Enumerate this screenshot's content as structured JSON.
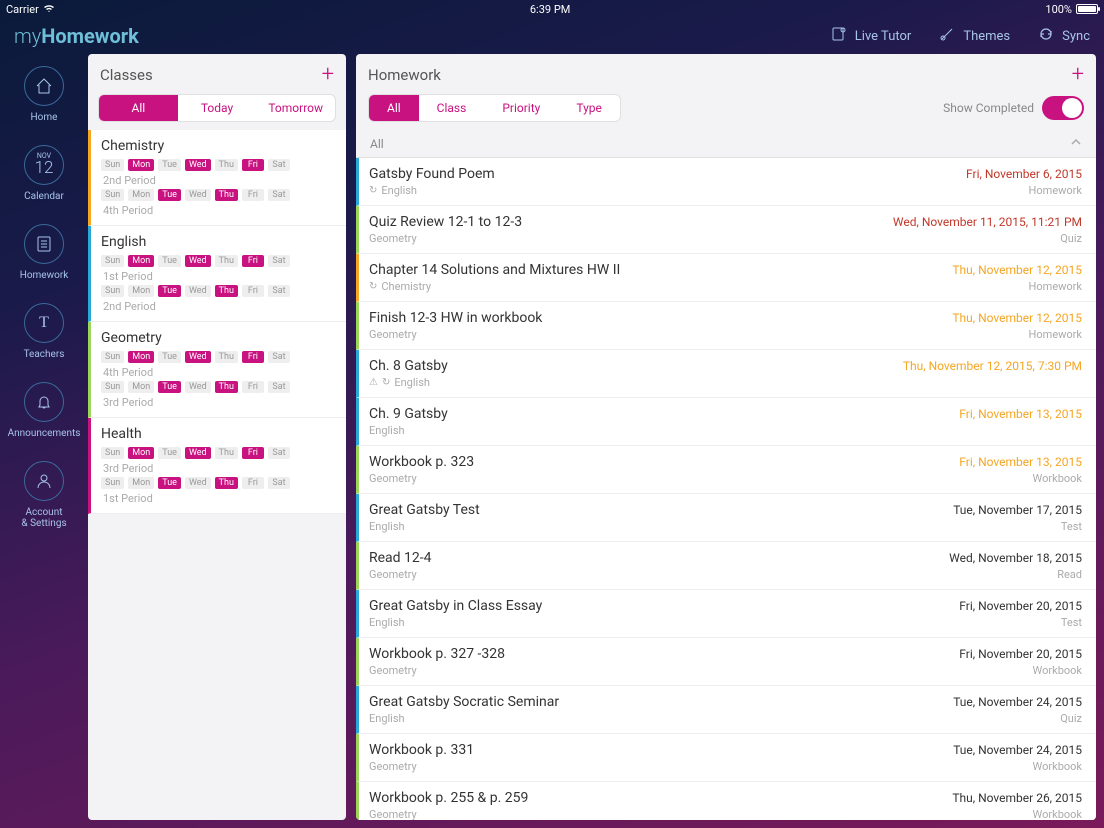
{
  "status": {
    "carrier": "Carrier",
    "time": "6:39 PM",
    "battery": "100%"
  },
  "logo": {
    "prefix": "my",
    "main": "Homework"
  },
  "top_actions": {
    "live_tutor": "Live Tutor",
    "themes": "Themes",
    "sync": "Sync"
  },
  "nav": {
    "home": "Home",
    "calendar": "Calendar",
    "cal_month": "NOV",
    "cal_day": "12",
    "homework": "Homework",
    "teachers": "Teachers",
    "announcements": "Announcements",
    "account1": "Account",
    "account2": "& Settings"
  },
  "classes": {
    "title": "Classes",
    "tabs": {
      "all": "All",
      "today": "Today",
      "tomorrow": "Tomorrow"
    },
    "days": [
      "Sun",
      "Mon",
      "Tue",
      "Wed",
      "Thu",
      "Fri",
      "Sat"
    ],
    "items": [
      {
        "name": "Chemistry",
        "color": "c-orange",
        "schedules": [
          {
            "on": [
              1,
              3,
              5
            ],
            "period": "2nd Period"
          },
          {
            "on": [
              2,
              4
            ],
            "period": "4th Period"
          }
        ]
      },
      {
        "name": "English",
        "color": "c-blue",
        "schedules": [
          {
            "on": [
              1,
              3,
              5
            ],
            "period": "1st Period"
          },
          {
            "on": [
              2,
              4
            ],
            "period": "2nd Period"
          }
        ]
      },
      {
        "name": "Geometry",
        "color": "c-green",
        "schedules": [
          {
            "on": [
              1,
              3,
              5
            ],
            "period": "4th Period"
          },
          {
            "on": [
              2,
              4
            ],
            "period": "3rd Period"
          }
        ]
      },
      {
        "name": "Health",
        "color": "c-pink",
        "schedules": [
          {
            "on": [
              1,
              3,
              5
            ],
            "period": "3rd Period"
          },
          {
            "on": [
              2,
              4
            ],
            "period": "1st Period"
          }
        ]
      }
    ]
  },
  "homework": {
    "title": "Homework",
    "tabs": {
      "all": "All",
      "class": "Class",
      "priority": "Priority",
      "type": "Type"
    },
    "show_completed": "Show Completed",
    "section": "All",
    "items": [
      {
        "title": "Gatsby Found Poem",
        "subject": "English",
        "date": "Fri, November 6, 2015",
        "type": "Homework",
        "color": "c-blue",
        "dateClass": "d-red",
        "icons": [
          "repeat"
        ]
      },
      {
        "title": "Quiz Review 12-1 to 12-3",
        "subject": "Geometry",
        "date": "Wed, November 11, 2015, 11:21 PM",
        "type": "Quiz",
        "color": "c-green",
        "dateClass": "d-red",
        "icons": []
      },
      {
        "title": "Chapter 14 Solutions and Mixtures HW II",
        "subject": "Chemistry",
        "date": "Thu, November 12, 2015",
        "type": "Homework",
        "color": "c-orange",
        "dateClass": "d-orange",
        "icons": [
          "repeat"
        ]
      },
      {
        "title": "Finish 12-3 HW in workbook",
        "subject": "Geometry",
        "date": "Thu, November 12, 2015",
        "type": "Homework",
        "color": "c-green",
        "dateClass": "d-orange",
        "icons": []
      },
      {
        "title": "Ch. 8 Gatsby",
        "subject": "English",
        "date": "Thu, November 12, 2015, 7:30 PM",
        "type": "",
        "color": "c-blue",
        "dateClass": "d-orange",
        "icons": [
          "alert",
          "repeat"
        ]
      },
      {
        "title": "Ch. 9 Gatsby",
        "subject": "English",
        "date": "Fri, November 13, 2015",
        "type": "",
        "color": "c-blue",
        "dateClass": "d-orange",
        "icons": []
      },
      {
        "title": "Workbook p. 323",
        "subject": "Geometry",
        "date": "Fri, November 13, 2015",
        "type": "Workbook",
        "color": "c-green",
        "dateClass": "d-orange",
        "icons": []
      },
      {
        "title": "Great Gatsby Test",
        "subject": "English",
        "date": "Tue, November 17, 2015",
        "type": "Test",
        "color": "c-blue",
        "dateClass": "d-dark",
        "icons": []
      },
      {
        "title": "Read 12-4",
        "subject": "Geometry",
        "date": "Wed, November 18, 2015",
        "type": "Read",
        "color": "c-green",
        "dateClass": "d-dark",
        "icons": []
      },
      {
        "title": "Great Gatsby in Class Essay",
        "subject": "English",
        "date": "Fri, November 20, 2015",
        "type": "Test",
        "color": "c-blue",
        "dateClass": "d-dark",
        "icons": []
      },
      {
        "title": "Workbook p. 327 -328",
        "subject": "Geometry",
        "date": "Fri, November 20, 2015",
        "type": "Workbook",
        "color": "c-green",
        "dateClass": "d-dark",
        "icons": []
      },
      {
        "title": "Great Gatsby Socratic Seminar",
        "subject": "English",
        "date": "Tue, November 24, 2015",
        "type": "Quiz",
        "color": "c-blue",
        "dateClass": "d-dark",
        "icons": []
      },
      {
        "title": "Workbook p. 331",
        "subject": "Geometry",
        "date": "Tue, November 24, 2015",
        "type": "Workbook",
        "color": "c-green",
        "dateClass": "d-dark",
        "icons": []
      },
      {
        "title": "Workbook p. 255 & p. 259",
        "subject": "Geometry",
        "date": "Thu, November 26, 2015",
        "type": "Workbook",
        "color": "c-green",
        "dateClass": "d-dark",
        "icons": []
      }
    ]
  }
}
